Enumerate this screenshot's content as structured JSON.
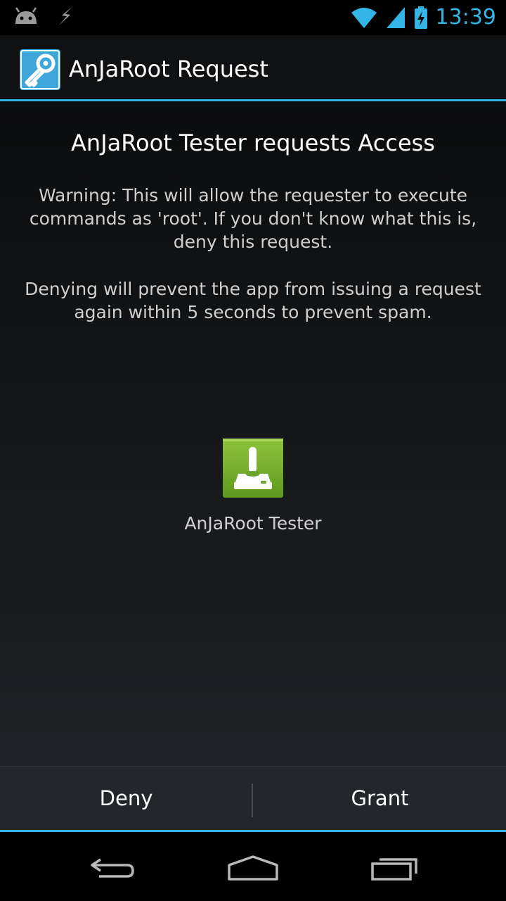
{
  "status_bar": {
    "time": "13:39",
    "left_icons": [
      "android-debug-icon",
      "usb-lightning-icon"
    ],
    "right_icons": [
      "wifi-icon",
      "signal-icon",
      "battery-charging-icon"
    ],
    "accent_color": "#33b5e5"
  },
  "action_bar": {
    "title": "AnJaRoot Request",
    "icon": "key-icon",
    "accent_color": "#33b5e5"
  },
  "request": {
    "heading": "AnJaRoot Tester requests Access",
    "warning": "Warning: This will allow the requester to execute commands as 'root'. If you don't know what this is, deny this request.",
    "denying_note": "Denying will prevent the app from issuing a request again within 5 seconds to prevent spam.",
    "app_icon": "joystick-icon",
    "app_name": "AnJaRoot Tester"
  },
  "buttons": {
    "deny_label": "Deny",
    "grant_label": "Grant"
  },
  "nav_bar": {
    "items": [
      "back-icon",
      "home-icon",
      "recents-icon"
    ]
  }
}
